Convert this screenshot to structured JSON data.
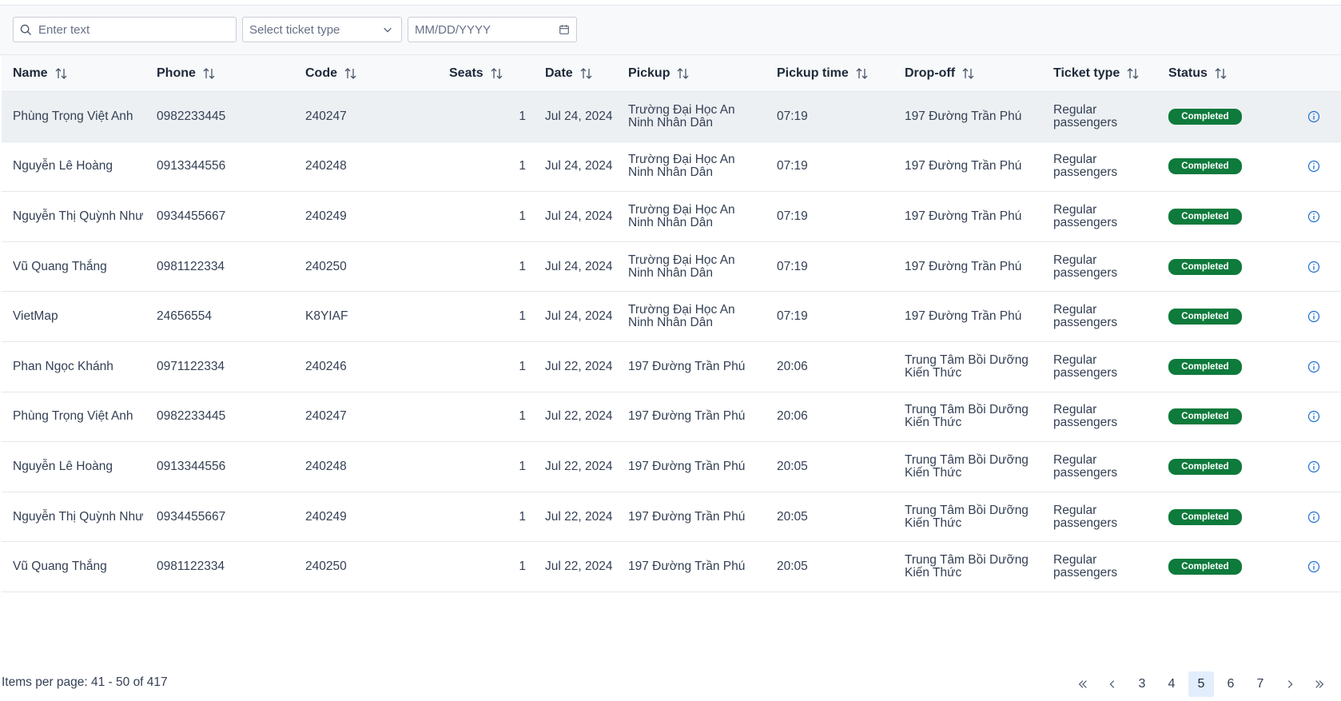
{
  "filters": {
    "search_placeholder": "Enter text",
    "ticket_type_placeholder": "Select ticket type",
    "date_placeholder": "MM/DD/YYYY"
  },
  "columns": {
    "name": "Name",
    "phone": "Phone",
    "code": "Code",
    "seats": "Seats",
    "date": "Date",
    "pickup": "Pickup",
    "pickup_time": "Pickup time",
    "dropoff": "Drop-off",
    "ticket_type": "Ticket type",
    "status": "Status"
  },
  "rows": [
    {
      "name": "Phùng Trọng Việt Anh",
      "phone": "0982233445",
      "code": "240247",
      "seats": "1",
      "date": "Jul 24, 2024",
      "pickup": "Trường Đại Học An Ninh Nhân Dân",
      "pickup_time": "07:19",
      "dropoff": "197 Đường Trần Phú",
      "ticket_type": "Regular passengers",
      "status": "Completed"
    },
    {
      "name": "Nguyễn Lê Hoàng",
      "phone": "0913344556",
      "code": "240248",
      "seats": "1",
      "date": "Jul 24, 2024",
      "pickup": "Trường Đại Học An Ninh Nhân Dân",
      "pickup_time": "07:19",
      "dropoff": "197 Đường Trần Phú",
      "ticket_type": "Regular passengers",
      "status": "Completed"
    },
    {
      "name": "Nguyễn Thị Quỳnh Như",
      "phone": "0934455667",
      "code": "240249",
      "seats": "1",
      "date": "Jul 24, 2024",
      "pickup": "Trường Đại Học An Ninh Nhân Dân",
      "pickup_time": "07:19",
      "dropoff": "197 Đường Trần Phú",
      "ticket_type": "Regular passengers",
      "status": "Completed"
    },
    {
      "name": "Vũ Quang Thắng",
      "phone": "0981122334",
      "code": "240250",
      "seats": "1",
      "date": "Jul 24, 2024",
      "pickup": "Trường Đại Học An Ninh Nhân Dân",
      "pickup_time": "07:19",
      "dropoff": "197 Đường Trần Phú",
      "ticket_type": "Regular passengers",
      "status": "Completed"
    },
    {
      "name": "VietMap",
      "phone": "24656554",
      "code": "K8YIAF",
      "seats": "1",
      "date": "Jul 24, 2024",
      "pickup": "Trường Đại Học An Ninh Nhân Dân",
      "pickup_time": "07:19",
      "dropoff": "197 Đường Trần Phú",
      "ticket_type": "Regular passengers",
      "status": "Completed"
    },
    {
      "name": "Phan Ngọc Khánh",
      "phone": "0971122334",
      "code": "240246",
      "seats": "1",
      "date": "Jul 22, 2024",
      "pickup": "197 Đường Trần Phú",
      "pickup_time": "20:06",
      "dropoff": "Trung Tâm Bồi Dưỡng Kiến Thức",
      "ticket_type": "Regular passengers",
      "status": "Completed"
    },
    {
      "name": "Phùng Trọng Việt Anh",
      "phone": "0982233445",
      "code": "240247",
      "seats": "1",
      "date": "Jul 22, 2024",
      "pickup": "197 Đường Trần Phú",
      "pickup_time": "20:06",
      "dropoff": "Trung Tâm Bồi Dưỡng Kiến Thức",
      "ticket_type": "Regular passengers",
      "status": "Completed"
    },
    {
      "name": "Nguyễn Lê Hoàng",
      "phone": "0913344556",
      "code": "240248",
      "seats": "1",
      "date": "Jul 22, 2024",
      "pickup": "197 Đường Trần Phú",
      "pickup_time": "20:05",
      "dropoff": "Trung Tâm Bồi Dưỡng Kiến Thức",
      "ticket_type": "Regular passengers",
      "status": "Completed"
    },
    {
      "name": "Nguyễn Thị Quỳnh Như",
      "phone": "0934455667",
      "code": "240249",
      "seats": "1",
      "date": "Jul 22, 2024",
      "pickup": "197 Đường Trần Phú",
      "pickup_time": "20:05",
      "dropoff": "Trung Tâm Bồi Dưỡng Kiến Thức",
      "ticket_type": "Regular passengers",
      "status": "Completed"
    },
    {
      "name": "Vũ Quang Thắng",
      "phone": "0981122334",
      "code": "240250",
      "seats": "1",
      "date": "Jul 22, 2024",
      "pickup": "197 Đường Trần Phú",
      "pickup_time": "20:05",
      "dropoff": "Trung Tâm Bồi Dưỡng Kiến Thức",
      "ticket_type": "Regular passengers",
      "status": "Completed"
    }
  ],
  "highlighted_row": 0,
  "pagination": {
    "items_text": "Items per page: 41 - 50 of 417",
    "pages": [
      "3",
      "4",
      "5",
      "6",
      "7"
    ],
    "current_page": "5"
  },
  "colors": {
    "status_completed": "#0e7a3b",
    "active_page_bg": "#e3eefc",
    "info_icon": "#1f6fd1"
  },
  "icons": {
    "search": "search-icon",
    "dropdown": "chevron-down-icon",
    "calendar": "calendar-icon",
    "sort": "sort-icon",
    "info": "info-icon",
    "first": "double-chevron-left-icon",
    "prev": "chevron-left-icon",
    "next": "chevron-right-icon",
    "last": "double-chevron-right-icon"
  }
}
